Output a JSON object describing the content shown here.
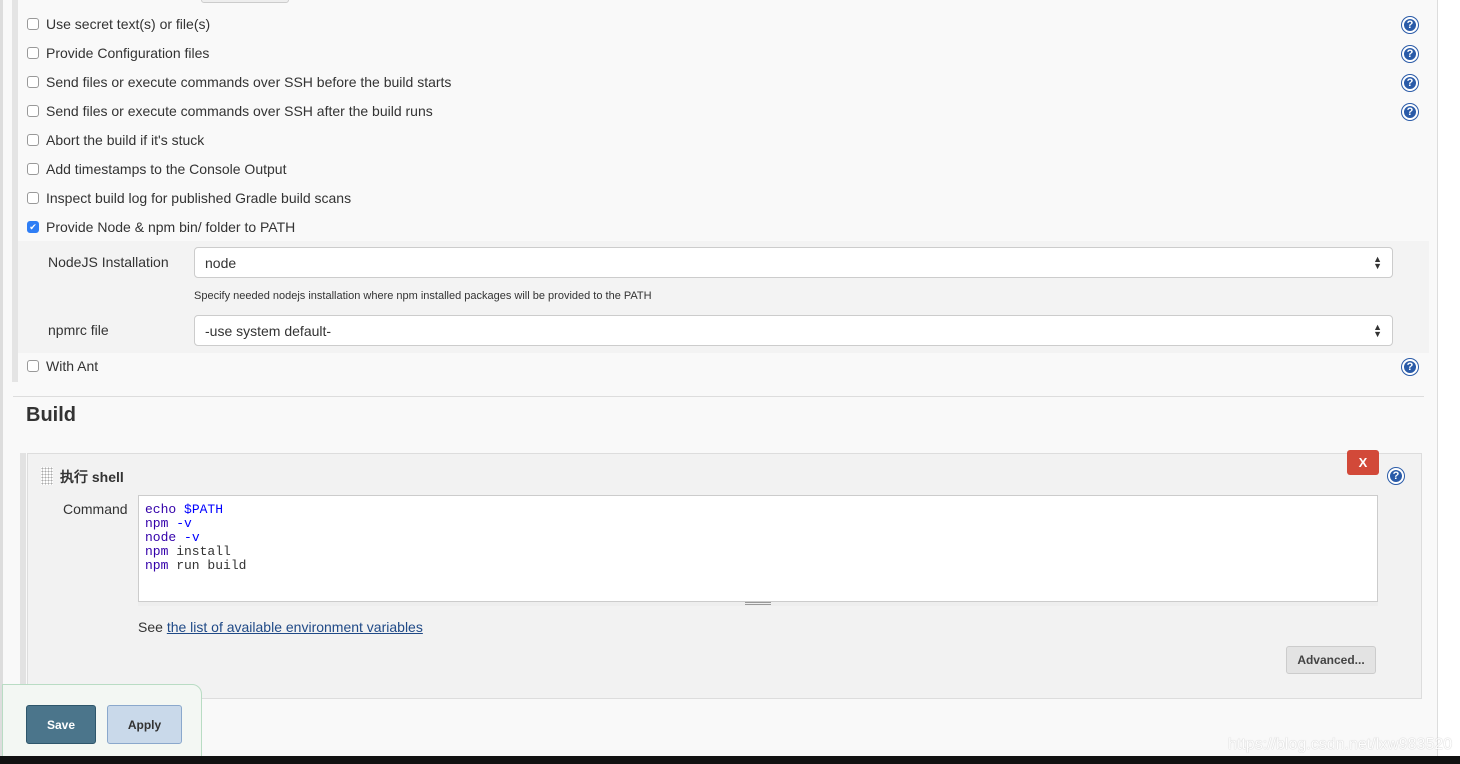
{
  "options": [
    {
      "label": "Use secret text(s) or file(s)",
      "checked": false,
      "help": true
    },
    {
      "label": "Provide Configuration files",
      "checked": false,
      "help": true
    },
    {
      "label": "Send files or execute commands over SSH before the build starts",
      "checked": false,
      "help": true
    },
    {
      "label": "Send files or execute commands over SSH after the build runs",
      "checked": false,
      "help": true
    },
    {
      "label": "Abort the build if it's stuck",
      "checked": false,
      "help": false
    },
    {
      "label": "Add timestamps to the Console Output",
      "checked": false,
      "help": false
    },
    {
      "label": "Inspect build log for published Gradle build scans",
      "checked": false,
      "help": false
    },
    {
      "label": "Provide Node & npm bin/ folder to PATH",
      "checked": true,
      "help": false
    }
  ],
  "nodejs": {
    "label": "NodeJS Installation",
    "value": "node",
    "hint": "Specify needed nodejs installation where npm installed packages will be provided to the PATH",
    "npmrc_label": "npmrc file",
    "npmrc_value": "-use system default-"
  },
  "with_ant": {
    "label": "With Ant",
    "checked": false
  },
  "build": {
    "heading": "Build",
    "step_title": "执行 shell",
    "delete_label": "X",
    "command_label": "Command",
    "command_lines": [
      "echo $PATH",
      "npm -v",
      "node -v",
      "npm install",
      "npm run build"
    ],
    "see_prefix": "See",
    "see_link": "the list of available environment variables",
    "advanced_label": "Advanced..."
  },
  "footer": {
    "save": "Save",
    "apply": "Apply"
  },
  "watermark": "https://blog.csdn.net/lxw983520",
  "colors": {
    "save": "#4b758b",
    "delete": "#d24939",
    "help": "#2a5ba8",
    "checkbox": "#2f7ef5"
  }
}
